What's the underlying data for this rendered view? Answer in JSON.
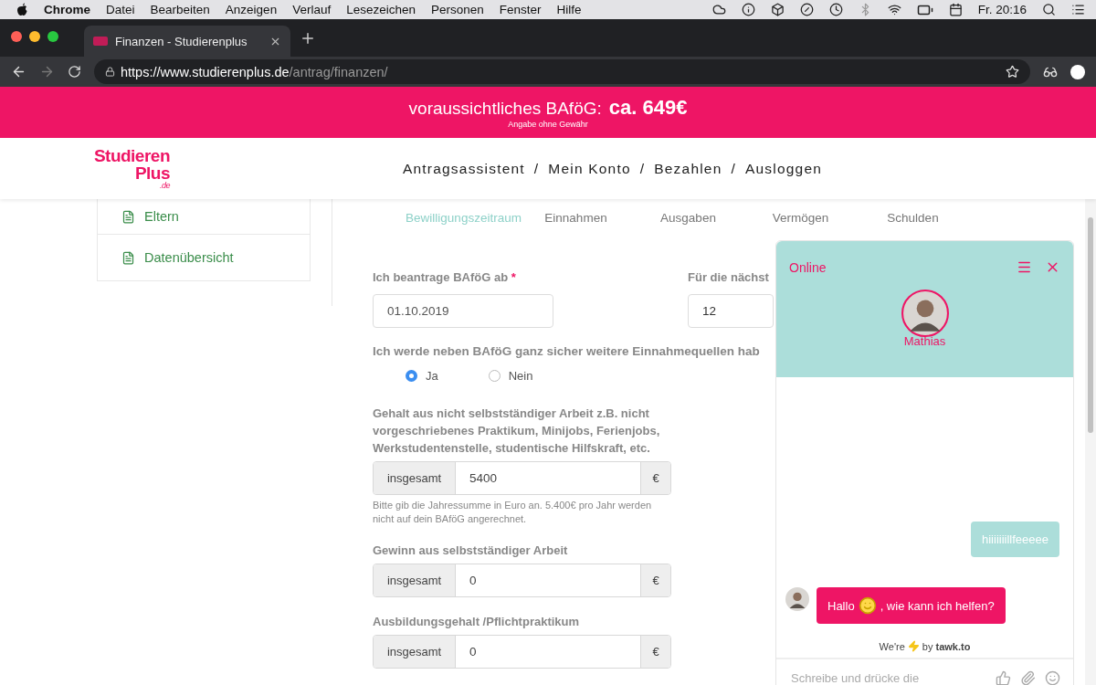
{
  "menubar": {
    "app": "Chrome",
    "items": [
      "Datei",
      "Bearbeiten",
      "Anzeigen",
      "Verlauf",
      "Lesezeichen",
      "Personen",
      "Fenster",
      "Hilfe"
    ],
    "clock": "Fr. 20:16"
  },
  "browser": {
    "tab_title": "Finanzen - Studierenplus",
    "url_host": "https://www.studierenplus.de",
    "url_path": "/antrag/finanzen/"
  },
  "banner": {
    "label": "voraussichtliches BAföG:",
    "amount": "ca. 649€",
    "note": "Angabe ohne Gewähr"
  },
  "logo": {
    "line_1": "Studieren",
    "line_2": "Plus",
    "suffix": ".de"
  },
  "nav": {
    "items": [
      "Antragsassistent",
      "Mein Konto",
      "Bezahlen",
      "Ausloggen"
    ],
    "separator": "/"
  },
  "sidebar": {
    "items": [
      "Eltern",
      "Datenübersicht"
    ]
  },
  "steps": [
    {
      "label": "Bewilligungszeitraum",
      "selected": true
    },
    {
      "label": "Einnahmen",
      "selected": false
    },
    {
      "label": "Ausgaben",
      "selected": false
    },
    {
      "label": "Vermögen",
      "selected": false
    },
    {
      "label": "Schulden",
      "selected": false
    }
  ],
  "form": {
    "start": {
      "label": "Ich beantrage BAföG ab",
      "required": "*",
      "value": "01.10.2019"
    },
    "months": {
      "label": "Für die nächst",
      "value": "12"
    },
    "question": "Ich werde neben BAföG ganz sicher weitere Einnahmequellen hab",
    "options": [
      {
        "label": "Ja",
        "selected": true
      },
      {
        "label": "Nein",
        "selected": false
      }
    ],
    "incomes": [
      {
        "label": "Gehalt aus nicht selbstständiger Arbeit z.B. nicht vorgeschriebenes Praktikum, Minijobs, Ferienjobs, Werkstudentenstelle, studentische Hilfskraft, etc.",
        "prefix": "insgesamt",
        "value": "5400",
        "suffix": "€",
        "hint": "Bitte gib die Jahressumme in Euro an. 5.400€ pro Jahr werden nicht auf dein BAföG angerechnet."
      },
      {
        "label": "Gewinn aus selbstständiger Arbeit",
        "prefix": "insgesamt",
        "value": "0",
        "suffix": "€"
      },
      {
        "label": "Ausbildungsgehalt /Pflichtpraktikum",
        "prefix": "insgesamt",
        "value": "0",
        "suffix": "€"
      }
    ]
  },
  "chat": {
    "status": "Online",
    "agent": "Mathias",
    "messages": [
      {
        "kind": "visitor",
        "text": "hiiiiiiillfeeeee"
      },
      {
        "kind": "agent",
        "before": "Hallo",
        "after": ", wie kann ich helfen?"
      }
    ],
    "footer_lead": "We're",
    "footer_brand": "by **tawk.to**",
    "placeholder": "Schreibe und drücke die"
  }
}
